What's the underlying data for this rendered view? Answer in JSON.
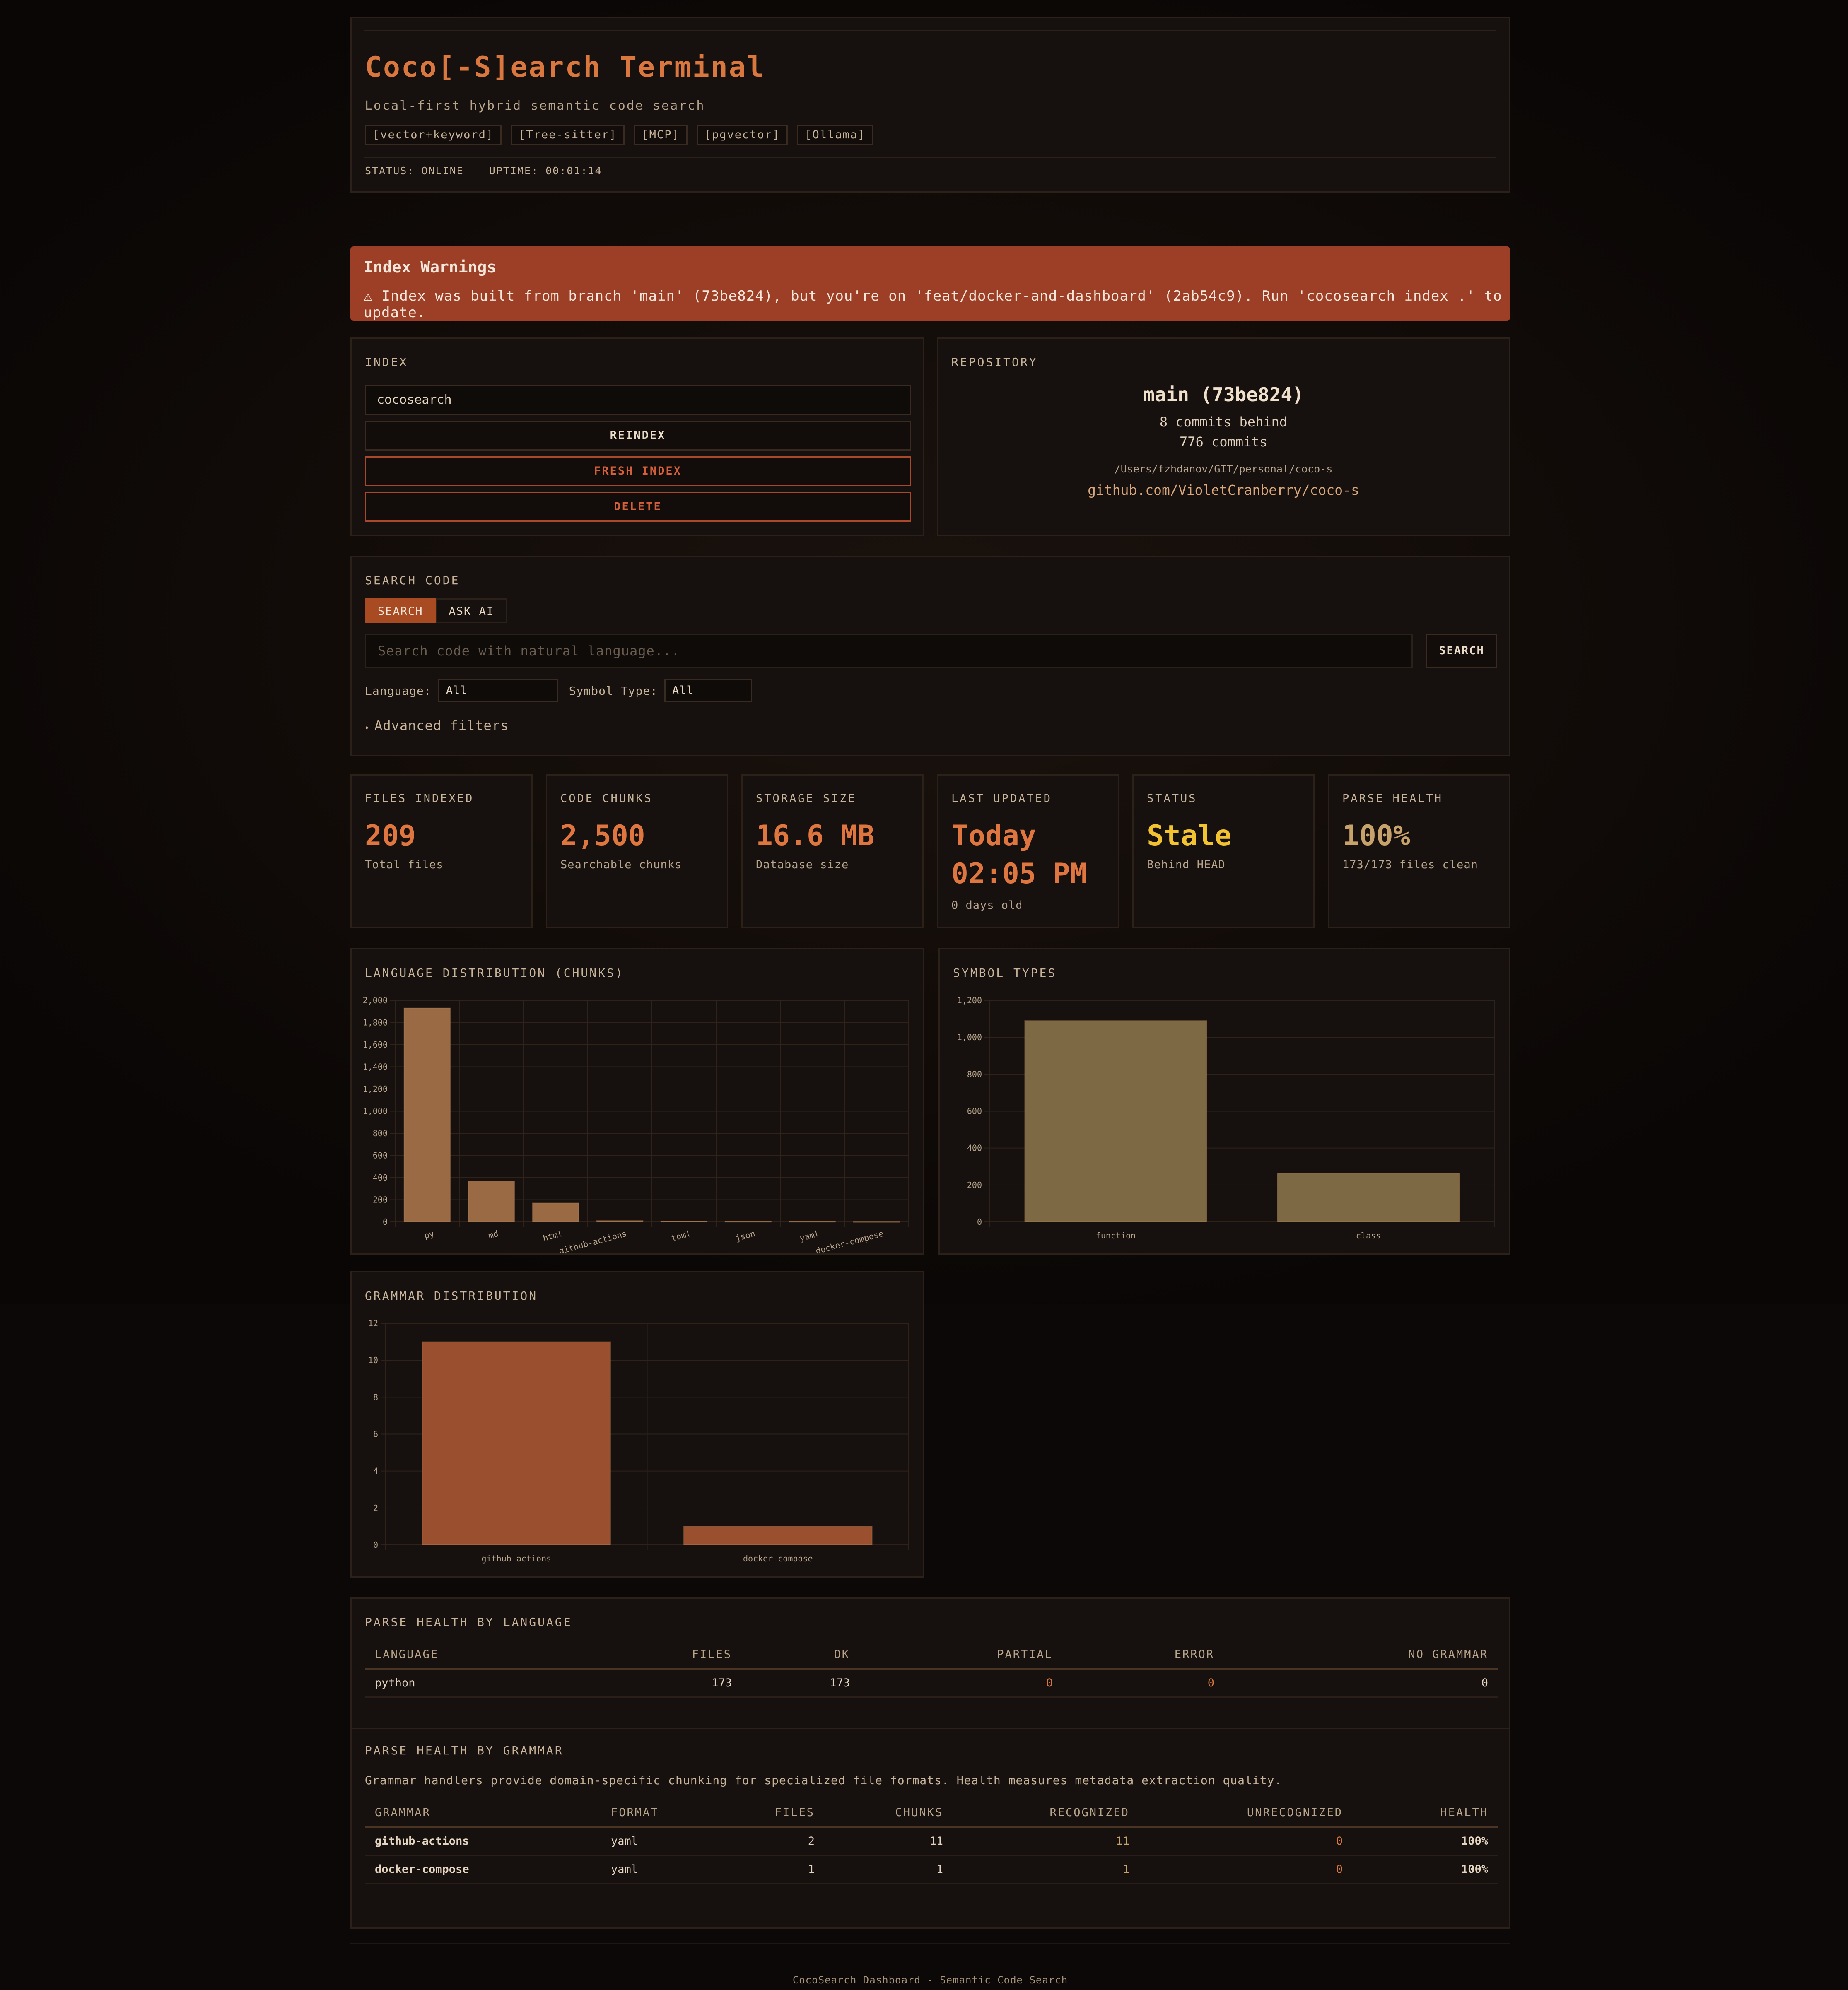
{
  "header": {
    "title": "Coco[-S]earch Terminal",
    "subtitle": "Local-first hybrid semantic code search",
    "tags": [
      "[vector+keyword]",
      "[Tree-sitter]",
      "[MCP]",
      "[pgvector]",
      "[Ollama]"
    ],
    "status": "STATUS: ONLINE",
    "uptime": "UPTIME: 00:01:14"
  },
  "warning": {
    "title": "Index Warnings",
    "icon": "⚠",
    "message": "Index was built from branch 'main' (73be824), but you're on 'feat/docker-and-dashboard' (2ab54c9). Run 'cocosearch index .' to update."
  },
  "index_panel": {
    "title": "INDEX",
    "index_name": "cocosearch",
    "reindex_label": "REINDEX",
    "fresh_label": "FRESH INDEX",
    "delete_label": "DELETE"
  },
  "repository": {
    "title": "REPOSITORY",
    "branch": "main (73be824)",
    "behind": "8 commits behind",
    "commits": "776 commits",
    "path": "/Users/fzhdanov/GIT/personal/coco-s",
    "url": "github.com/VioletCranberry/coco-s"
  },
  "search": {
    "title": "SEARCH CODE",
    "tabs": [
      {
        "label": "SEARCH",
        "active": true
      },
      {
        "label": "ASK AI",
        "active": false
      }
    ],
    "placeholder": "Search code with natural language...",
    "button": "SEARCH",
    "language_label": "Language:",
    "language_value": "All",
    "symbol_label": "Symbol Type:",
    "symbol_value": "All",
    "advanced": "Advanced filters",
    "advanced_icon": "▸"
  },
  "stats": [
    {
      "label": "FILES INDEXED",
      "value": "209",
      "sub": "Total files",
      "color": "#e0763f"
    },
    {
      "label": "CODE CHUNKS",
      "value": "2,500",
      "sub": "Searchable chunks",
      "color": "#e0763f"
    },
    {
      "label": "STORAGE SIZE",
      "value": "16.6 MB",
      "sub": "Database size",
      "color": "#e0763f"
    },
    {
      "label": "LAST UPDATED",
      "value": "Today",
      "value2": "02:05 PM",
      "sub": "0 days old",
      "color": "#e0763f"
    },
    {
      "label": "STATUS",
      "value": "Stale",
      "sub": "Behind HEAD",
      "color": "#f2c230"
    },
    {
      "label": "PARSE HEALTH",
      "value": "100%",
      "sub": "173/173 files clean",
      "color": "#c7a26a"
    }
  ],
  "chart_data": [
    {
      "type": "bar",
      "title": "LANGUAGE DISTRIBUTION (CHUNKS)",
      "categories": [
        "py",
        "md",
        "html",
        "github-actions",
        "toml",
        "json",
        "yaml",
        "docker-compose"
      ],
      "values": [
        1930,
        370,
        170,
        11,
        4,
        3,
        3,
        1
      ],
      "ylim": [
        0,
        2000
      ],
      "yticks": [
        "0",
        "200",
        "400",
        "600",
        "800",
        "1,000",
        "1,200",
        "1,400",
        "1,600",
        "1,800",
        "2,000"
      ],
      "color": "#9a6a45",
      "grid": true
    },
    {
      "type": "bar",
      "title": "SYMBOL TYPES",
      "categories": [
        "function",
        "class"
      ],
      "values": [
        1090,
        262
      ],
      "ylim": [
        0,
        1200
      ],
      "yticks": [
        "0",
        "200",
        "400",
        "600",
        "800",
        "1,000",
        "1,200"
      ],
      "color": "#7d6a45",
      "grid": true
    },
    {
      "type": "bar",
      "title": "GRAMMAR DISTRIBUTION",
      "categories": [
        "github-actions",
        "docker-compose"
      ],
      "values": [
        11,
        1
      ],
      "ylim": [
        0,
        12
      ],
      "yticks": [
        "0",
        "2",
        "4",
        "6",
        "8",
        "10",
        "12"
      ],
      "color": "#9a4f2e",
      "grid": true
    }
  ],
  "parse_lang": {
    "title": "PARSE HEALTH BY LANGUAGE",
    "headers": [
      "LANGUAGE",
      "FILES",
      "OK",
      "PARTIAL",
      "ERROR",
      "NO GRAMMAR"
    ],
    "rows": [
      [
        "python",
        "173",
        "173",
        "0",
        "0",
        "0"
      ]
    ]
  },
  "parse_grammar": {
    "title": "PARSE HEALTH BY GRAMMAR",
    "description": "Grammar handlers provide domain-specific chunking for specialized file formats. Health measures metadata extraction quality.",
    "headers": [
      "GRAMMAR",
      "FORMAT",
      "FILES",
      "CHUNKS",
      "RECOGNIZED",
      "UNRECOGNIZED",
      "HEALTH"
    ],
    "rows": [
      [
        "github-actions",
        "yaml",
        "2",
        "11",
        "11",
        "0",
        "100%"
      ],
      [
        "docker-compose",
        "yaml",
        "1",
        "1",
        "1",
        "0",
        "100%"
      ]
    ]
  },
  "footer": "CocoSearch Dashboard - Semantic Code Search"
}
